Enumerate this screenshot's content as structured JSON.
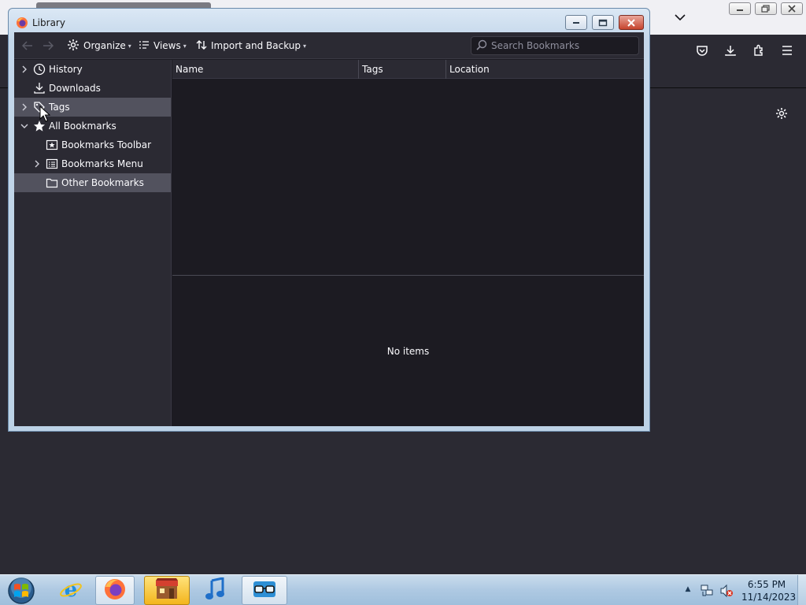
{
  "library": {
    "title": "Library",
    "toolbar": {
      "organize": "Organize",
      "views": "Views",
      "import_backup": "Import and Backup",
      "search_placeholder": "Search Bookmarks"
    },
    "sidebar": {
      "items": [
        {
          "label": "History",
          "icon": "clock-icon",
          "expandable": true,
          "expanded": false
        },
        {
          "label": "Downloads",
          "icon": "download-icon",
          "expandable": false
        },
        {
          "label": "Tags",
          "icon": "tag-icon",
          "expandable": true,
          "expanded": false,
          "highlighted": true
        },
        {
          "label": "All Bookmarks",
          "icon": "star-icon",
          "expandable": true,
          "expanded": true
        },
        {
          "label": "Bookmarks Toolbar",
          "icon": "bookmarks-toolbar-icon",
          "expandable": false
        },
        {
          "label": "Bookmarks Menu",
          "icon": "bookmarks-menu-icon",
          "expandable": true,
          "expanded": false
        },
        {
          "label": "Other Bookmarks",
          "icon": "folder-icon",
          "expandable": false,
          "selected": true
        }
      ]
    },
    "columns": [
      "Name",
      "Tags",
      "Location"
    ],
    "details_empty": "No items"
  },
  "taskbar": {
    "time": "6:55 PM",
    "date": "11/14/2023"
  },
  "colors": {
    "dark_bg": "#1c1b22",
    "toolbar_bg": "#2b2a33",
    "highlight": "#52525e",
    "taskbar_active_app": "#f3b51d"
  }
}
